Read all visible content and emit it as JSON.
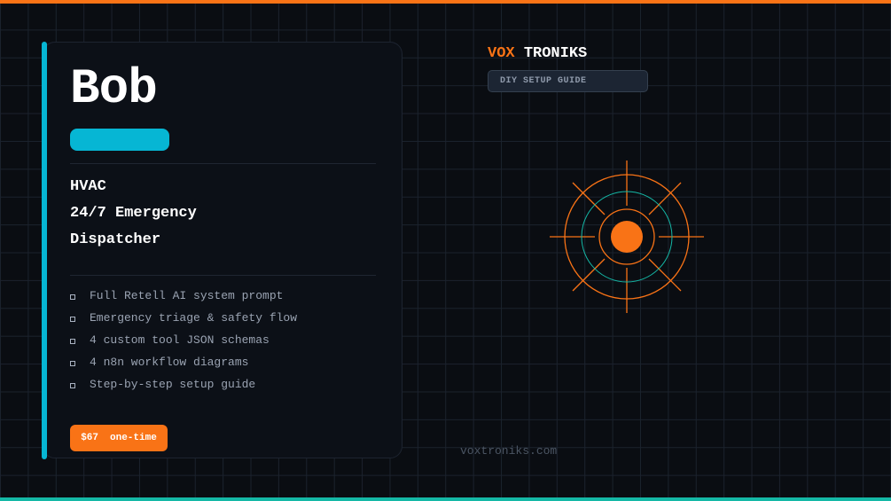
{
  "agent": {
    "name": "Bob",
    "role_lines": [
      "HVAC",
      "24/7 Emergency",
      "Dispatcher"
    ]
  },
  "features": [
    "Full Retell AI system prompt",
    "Emergency triage & safety flow",
    "4 custom tool JSON schemas",
    "4 n8n workflow diagrams",
    "Step-by-step setup guide"
  ],
  "price": {
    "amount": "$67",
    "term": "one-time"
  },
  "brand": {
    "part1": "VOX",
    "part2": "TRONIKS",
    "badge": "DIY SETUP GUIDE"
  },
  "footer": {
    "url": "voxtroniks.com"
  },
  "colors": {
    "accent_orange": "#f97316",
    "accent_cyan": "#06b6d4",
    "accent_teal": "#14b8a6",
    "background": "#0a0d12"
  },
  "icons": {
    "target": "crosshair-target-icon",
    "bullet": "square-bullet-icon"
  }
}
